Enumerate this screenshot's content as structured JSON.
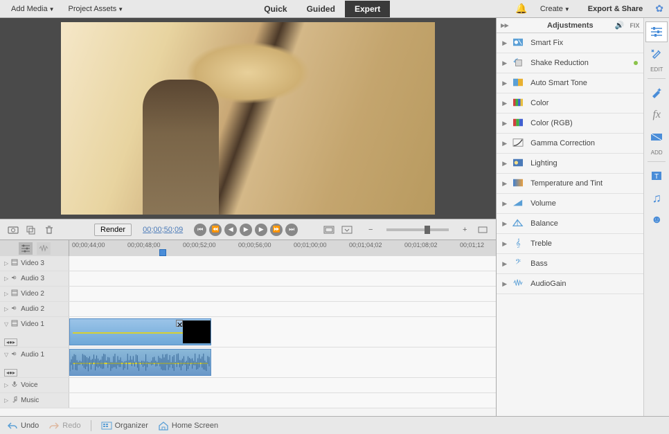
{
  "topbar": {
    "add_media": "Add Media",
    "project_assets": "Project Assets",
    "modes": [
      "Quick",
      "Guided",
      "Expert"
    ],
    "active_mode": "Expert",
    "create": "Create",
    "export": "Export & Share"
  },
  "controls": {
    "render": "Render",
    "timecode": "00;00;50;09"
  },
  "ruler_ticks": [
    "00;00;44;00",
    "00;00;48;00",
    "00;00;52;00",
    "00;00;56;00",
    "00;01;00;00",
    "00;01;04;02",
    "00;01;08;02",
    "00;01;12"
  ],
  "tracks": [
    {
      "icon": "film",
      "label": "Video 3",
      "tall": false
    },
    {
      "icon": "speaker",
      "label": "Audio 3",
      "tall": false
    },
    {
      "icon": "film",
      "label": "Video 2",
      "tall": false
    },
    {
      "icon": "speaker",
      "label": "Audio 2",
      "tall": false
    },
    {
      "icon": "film",
      "label": "Video 1",
      "tall": true,
      "clip": true,
      "clip_kind": "video"
    },
    {
      "icon": "speaker",
      "label": "Audio 1",
      "tall": true,
      "clip": true,
      "clip_kind": "audio"
    },
    {
      "icon": "mic",
      "label": "Voice",
      "tall": false
    },
    {
      "icon": "music",
      "label": "Music",
      "tall": false
    }
  ],
  "adjustments": {
    "title": "Adjustments",
    "fix": "FIX",
    "items": [
      {
        "name": "Smart Fix",
        "icon": "fix",
        "dot": false
      },
      {
        "name": "Shake Reduction",
        "icon": "shake",
        "dot": true
      },
      {
        "name": "Auto Smart Tone",
        "icon": "tone",
        "dot": false
      },
      {
        "name": "Color",
        "icon": "color",
        "dot": false
      },
      {
        "name": "Color (RGB)",
        "icon": "colorrgb",
        "dot": false
      },
      {
        "name": "Gamma Correction",
        "icon": "gamma",
        "dot": false
      },
      {
        "name": "Lighting",
        "icon": "lighting",
        "dot": false
      },
      {
        "name": "Temperature and Tint",
        "icon": "temp",
        "dot": false
      },
      {
        "name": "Volume",
        "icon": "volume",
        "dot": false
      },
      {
        "name": "Balance",
        "icon": "balance",
        "dot": false
      },
      {
        "name": "Treble",
        "icon": "treble",
        "dot": false
      },
      {
        "name": "Bass",
        "icon": "bass",
        "dot": false
      },
      {
        "name": "AudioGain",
        "icon": "gain",
        "dot": false
      }
    ]
  },
  "toolrail": {
    "edit_label": "EDIT",
    "add_label": "ADD"
  },
  "bottombar": {
    "undo": "Undo",
    "redo": "Redo",
    "organizer": "Organizer",
    "home": "Home Screen"
  }
}
